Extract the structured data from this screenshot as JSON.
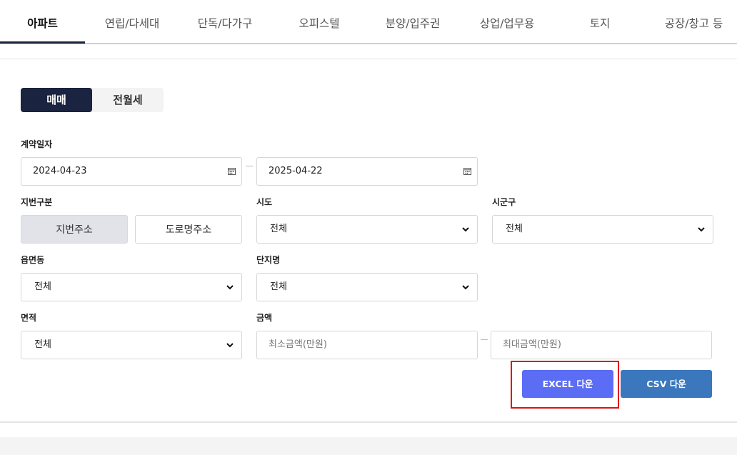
{
  "tabs": [
    {
      "label": "아파트"
    },
    {
      "label": "연립/다세대"
    },
    {
      "label": "단독/다가구"
    },
    {
      "label": "오피스텔"
    },
    {
      "label": "분양/입주권"
    },
    {
      "label": "상업/업무용"
    },
    {
      "label": "토지"
    },
    {
      "label": "공장/창고 등"
    }
  ],
  "trade_type": {
    "sale": "매매",
    "rent": "전월세"
  },
  "contract_date": {
    "label": "계약일자",
    "from": "2024-04-23",
    "to": "2025-04-22"
  },
  "lot_type": {
    "label": "지번구분",
    "lot": "지번주소",
    "road": "도로명주소"
  },
  "sido": {
    "label": "시도",
    "value": "전체"
  },
  "sigungu": {
    "label": "시군구",
    "value": "전체"
  },
  "eupmyeondong": {
    "label": "읍면동",
    "value": "전체"
  },
  "complex": {
    "label": "단지명",
    "value": "전체"
  },
  "area": {
    "label": "면적",
    "value": "전체"
  },
  "price": {
    "label": "금액",
    "min_placeholder": "최소금액(만원)",
    "max_placeholder": "최대금액(만원)"
  },
  "actions": {
    "excel": "EXCEL 다운",
    "csv": "CSV 다운"
  },
  "colors": {
    "navy": "#1a2440",
    "excel": "#5b6cf5",
    "csv": "#3a77bd",
    "highlight": "#e01010"
  }
}
